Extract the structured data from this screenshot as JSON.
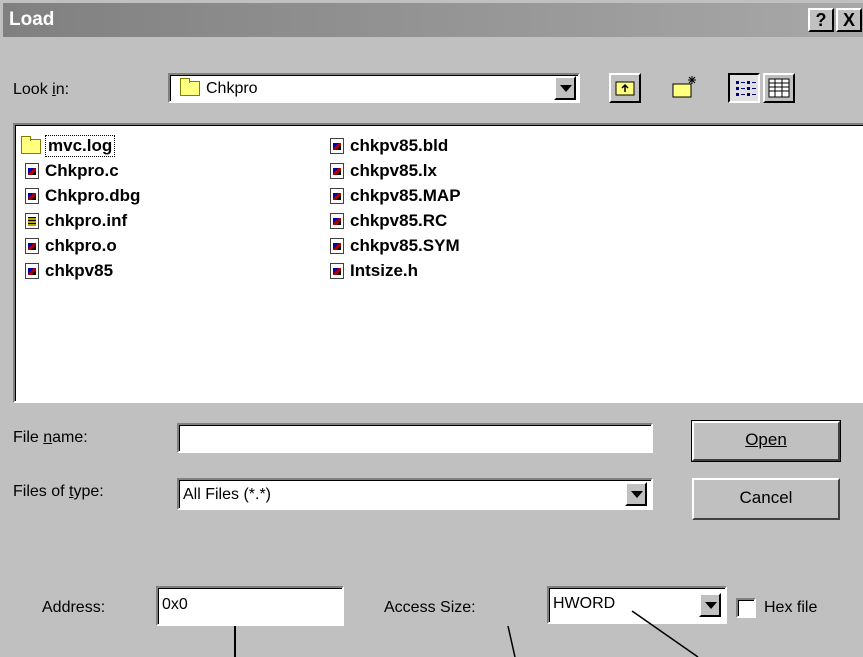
{
  "window": {
    "title": "Load",
    "help_label": "?",
    "close_label": "X"
  },
  "look_in": {
    "label": "Look in:",
    "value": "Chkpro",
    "folder_icon": "folder-icon"
  },
  "toolbar": [
    "up-folder-icon",
    "new-folder-icon",
    "list-view-icon",
    "details-view-icon"
  ],
  "files": {
    "column1": [
      {
        "name": "mvc.log",
        "icon": "folder-icon"
      },
      {
        "name": "Chkpro.c",
        "icon": "file-icon"
      },
      {
        "name": "Chkpro.dbg",
        "icon": "file-icon"
      },
      {
        "name": "chkpro.inf",
        "icon": "inf-file-icon"
      },
      {
        "name": "chkpro.o",
        "icon": "file-icon"
      },
      {
        "name": "chkpv85",
        "icon": "file-icon"
      }
    ],
    "column2": [
      {
        "name": "chkpv85.bld",
        "icon": "file-icon"
      },
      {
        "name": "chkpv85.lx",
        "icon": "file-icon"
      },
      {
        "name": "chkpv85.MAP",
        "icon": "file-icon"
      },
      {
        "name": "chkpv85.RC",
        "icon": "file-icon"
      },
      {
        "name": "chkpv85.SYM",
        "icon": "file-icon"
      },
      {
        "name": "Intsize.h",
        "icon": "file-icon"
      }
    ]
  },
  "file_name": {
    "label": "File name:",
    "value": ""
  },
  "files_of_type": {
    "label": "Files of type:",
    "value": "All Files (*.*)"
  },
  "buttons": {
    "open": "Open",
    "cancel": "Cancel"
  },
  "address": {
    "label": "Address:",
    "value": "0x0"
  },
  "access_size": {
    "label": "Access Size:",
    "value": "HWORD"
  },
  "hex_file": {
    "label": "Hex file",
    "checked": false
  }
}
